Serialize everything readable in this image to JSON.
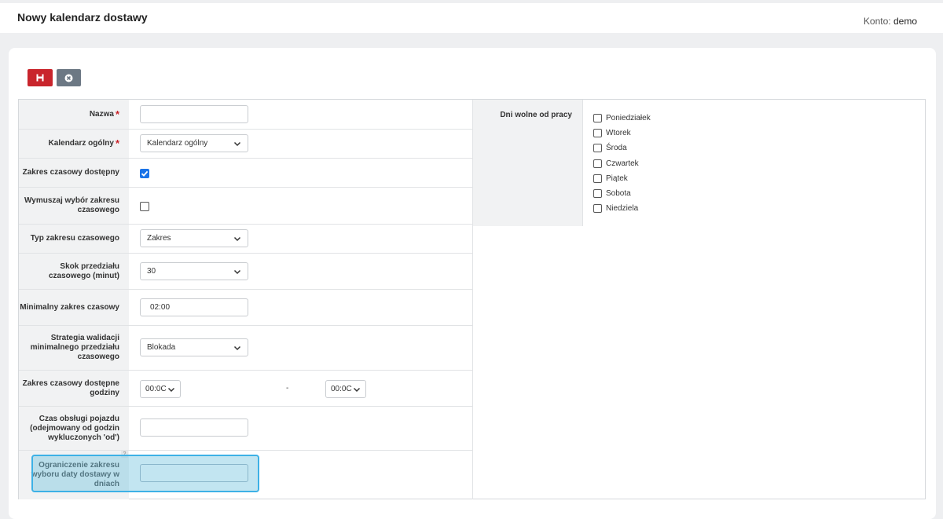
{
  "header": {
    "title": "Nowy kalendarz dostawy",
    "account_label": "Konto:",
    "account_value": "demo"
  },
  "toolbar": {
    "save_icon": "save-icon",
    "cancel_icon": "close-circle-icon"
  },
  "form": {
    "name": {
      "label": "Nazwa",
      "required": "*",
      "value": ""
    },
    "general_calendar": {
      "label": "Kalendarz ogólny",
      "required": "*",
      "value": "Kalendarz ogólny"
    },
    "time_range_available": {
      "label": "Zakres czasowy dostępny",
      "checked": true
    },
    "force_time_range": {
      "label": "Wymuszaj wybór zakresu czasowego",
      "checked": false
    },
    "time_range_type": {
      "label": "Typ zakresu czasowego",
      "value": "Zakres"
    },
    "interval_step": {
      "label": "Skok przedziału czasowego (minut)",
      "value": "30"
    },
    "min_range": {
      "label": "Minimalny zakres czasowy",
      "value": "02:00"
    },
    "validation_strategy": {
      "label": "Strategia walidacji minimalnego przedziału czasowego",
      "value": "Blokada"
    },
    "available_hours": {
      "label": "Zakres czasowy dostępne godziny",
      "from": "00:0C",
      "separator": "-",
      "to": "00:0C"
    },
    "vehicle_handling": {
      "label": "Czas obsługi pojazdu (odejmowany od godzin wykluczonych 'od')",
      "value": ""
    },
    "date_limit": {
      "label": "Ograniczenie zakresu wyboru daty dostawy w dniach",
      "value": "",
      "help": "?"
    }
  },
  "days_off": {
    "label": "Dni wolne od pracy",
    "days": [
      {
        "name": "Poniedziałek",
        "checked": false
      },
      {
        "name": "Wtorek",
        "checked": false
      },
      {
        "name": "Środa",
        "checked": false
      },
      {
        "name": "Czwartek",
        "checked": false
      },
      {
        "name": "Piątek",
        "checked": false
      },
      {
        "name": "Sobota",
        "checked": false
      },
      {
        "name": "Niedziela",
        "checked": false
      }
    ]
  },
  "colors": {
    "save": "#c9252c",
    "cancel": "#6c7884",
    "checkbox_checked": "#1a73e8",
    "highlight_border": "#3db1e6"
  }
}
